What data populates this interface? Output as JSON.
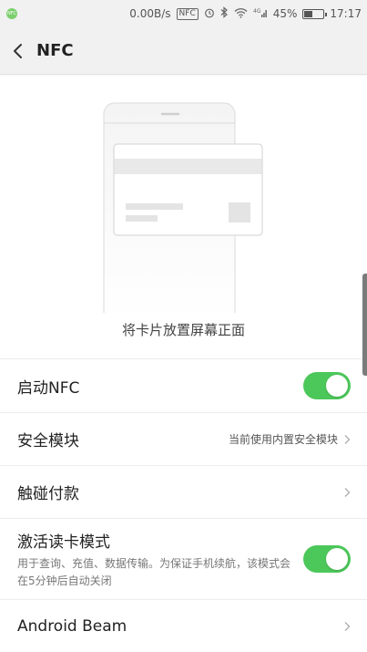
{
  "status_bar": {
    "nfc_dot": "NFC",
    "speed": "0.00B/s",
    "nfc_badge": "NFC",
    "network": "4G",
    "battery_percent": "45%",
    "battery_level": 0.45,
    "time": "17:17",
    "icons": [
      "alarm-icon",
      "bluetooth-icon",
      "wifi-icon",
      "signal-icon"
    ]
  },
  "header": {
    "title": "NFC",
    "back_icon": "chevron-left-icon"
  },
  "illustration": {
    "hint": "将卡片放置屏幕正面"
  },
  "settings": {
    "enable_nfc": {
      "label": "启动NFC",
      "on": true
    },
    "secure_element": {
      "label": "安全模块",
      "value": "当前使用内置安全模块"
    },
    "tap_pay": {
      "label": "触碰付款"
    },
    "reader_mode": {
      "label": "激活读卡模式",
      "description": "用于查询、充值、数据传输。为保证手机续航，该模式会在5分钟后自动关闭",
      "on": true
    },
    "android_beam": {
      "label": "Android Beam"
    }
  },
  "colors": {
    "toggle_on": "#4cc75a",
    "header_bg": "#f1f1f1",
    "page_bg": "#ffffff"
  }
}
